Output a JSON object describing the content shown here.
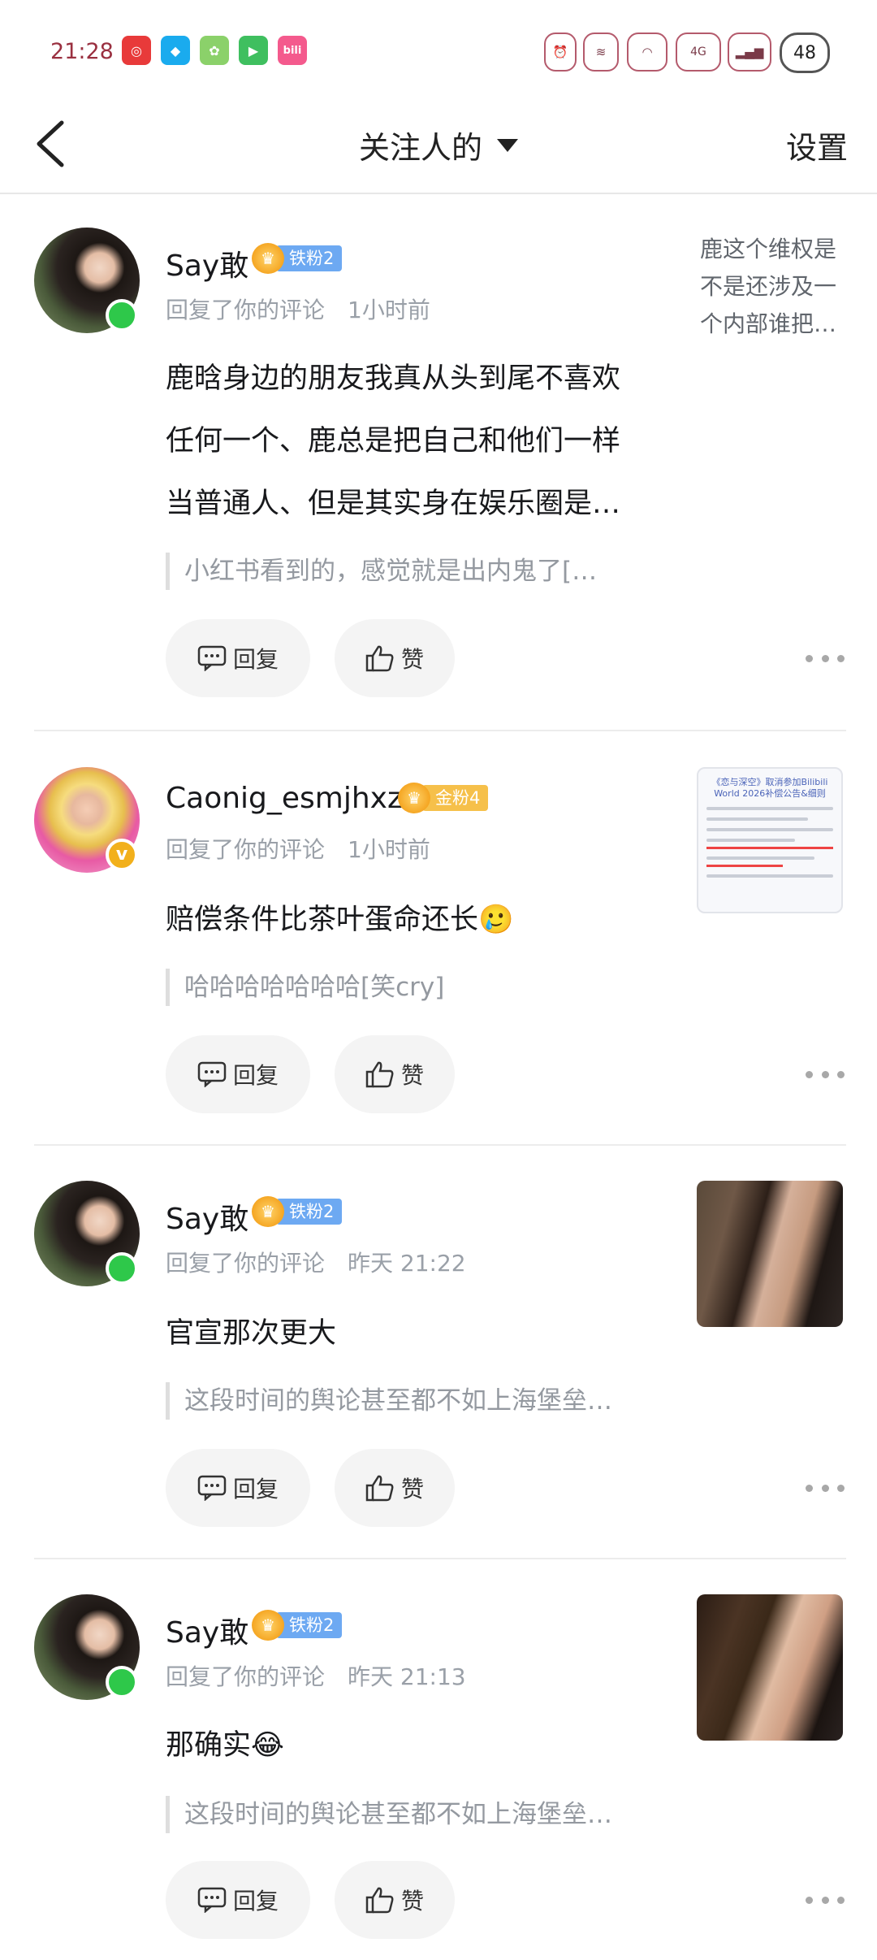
{
  "status_bar": {
    "time": "21:28",
    "apps": [
      {
        "icon": "netease-music-icon",
        "glyph": "◎",
        "color": "#e83a3a"
      },
      {
        "icon": "qq-icon",
        "glyph": "◆",
        "color": "#1aabee"
      },
      {
        "icon": "app-icon",
        "glyph": "✿",
        "color": "#8bd16a"
      },
      {
        "icon": "video-app-icon",
        "glyph": "▶",
        "color": "#3fbf5f"
      },
      {
        "icon": "bilibili-icon",
        "glyph": "bili",
        "color": "#f45a8d"
      }
    ],
    "network": "4G",
    "battery": "48"
  },
  "nav": {
    "title": "关注人的",
    "settings": "设置"
  },
  "actions": {
    "reply": "回复",
    "like": "赞"
  },
  "notifications": [
    {
      "username": "Say敢",
      "fan_badge": "铁粉2",
      "action": "回复了你的评论",
      "time": "1小时前",
      "content": "鹿晗身边的朋友我真从头到尾不喜欢任何一个、鹿总是把自己和他们一样当普通人、但是其实身在娱乐圈是…",
      "quote": "小红书看到的，感觉就是出内鬼了[…",
      "side_text": "鹿这个维权是不是还涉及一个内部谁把…"
    },
    {
      "username": "Caonig_esmjhxzsl",
      "fan_badge": "金粉4",
      "action": "回复了你的评论",
      "time": "1小时前",
      "content": "赔偿条件比茶叶蛋命还长🥲",
      "quote": "哈哈哈哈哈哈哈[笑cry]",
      "thumb_title": "《恋与深空》取消参加Bilibili World 2026补偿公告&细则"
    },
    {
      "username": "Say敢",
      "fan_badge": "铁粉2",
      "action": "回复了你的评论",
      "time": "昨天 21:22",
      "content": "官宣那次更大",
      "quote": "这段时间的舆论甚至都不如上海堡垒…"
    },
    {
      "username": "Say敢",
      "fan_badge": "铁粉2",
      "action": "回复了你的评论",
      "time": "昨天 21:13",
      "content": "那确实😂",
      "quote": "这段时间的舆论甚至都不如上海堡垒…"
    }
  ]
}
